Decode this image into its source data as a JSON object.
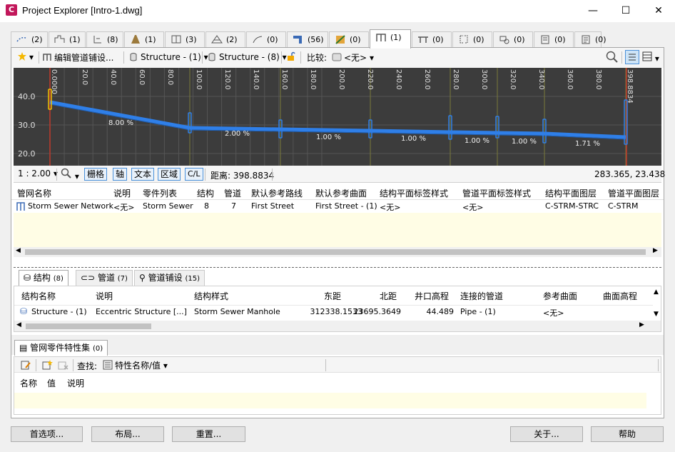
{
  "window": {
    "app_icon": "C",
    "title": "Project Explorer [Intro-1.dwg]",
    "minimize": "—",
    "maximize": "☐",
    "close": "✕"
  },
  "tabs": [
    {
      "icon": "alignment-icon",
      "count": "(2)"
    },
    {
      "icon": "profile-icon",
      "count": "(1)"
    },
    {
      "icon": "profile-view-icon",
      "count": "(8)"
    },
    {
      "icon": "corridor-icon",
      "count": "(1)"
    },
    {
      "icon": "assembly-icon",
      "count": "(3)"
    },
    {
      "icon": "surface-icon",
      "count": "(2)"
    },
    {
      "icon": "feature-line-icon",
      "count": "(0)"
    },
    {
      "icon": "pipe-icon",
      "count": "(56)"
    },
    {
      "icon": "corridor-surface-icon",
      "count": "(0)"
    },
    {
      "icon": "pipe-network-icon",
      "count": "(1)"
    },
    {
      "icon": "pressure-network-icon",
      "count": "(0)"
    },
    {
      "icon": "section-icon",
      "count": "(0)"
    },
    {
      "icon": "parcel-icon",
      "count": "(0)"
    },
    {
      "icon": "sheet-icon",
      "count": "(0)"
    },
    {
      "icon": "report-icon",
      "count": "(0)"
    }
  ],
  "toolbar": {
    "edit_pipe": "编辑管道铺设...",
    "structure_a": "Structure - (1)",
    "structure_b": "Structure - (8)",
    "compare_label": "比较:",
    "compare_value": "<无>"
  },
  "profile": {
    "y_labels": [
      "40.0",
      "30.0",
      "20.0"
    ],
    "x_labels": [
      "0.0000",
      "20.0",
      "40.0",
      "60.0",
      "80.0",
      "100.0",
      "120.0",
      "140.0",
      "160.0",
      "180.0",
      "200.0",
      "220.0",
      "240.0",
      "260.0",
      "280.0",
      "300.0",
      "320.0",
      "340.0",
      "360.0",
      "380.0",
      "398.8834"
    ],
    "slopes": [
      "8.00 %",
      "2.00 %",
      "1.00 %",
      "1.00 %",
      "1.00 %",
      "1.00 %",
      "1.71 %"
    ]
  },
  "viewbar": {
    "scale": "1 : 2.00",
    "grid": "栅格",
    "axis": "轴",
    "text": "文本",
    "region": "区域",
    "cl": "C/L",
    "distance": "距离: 398.8834",
    "coords": "283.365, 23.438"
  },
  "network_table": {
    "headers": [
      "管网名称",
      "说明",
      "零件列表",
      "结构",
      "管道",
      "默认参考路线",
      "默认参考曲面",
      "结构平面标签样式",
      "管道平面标签样式",
      "结构平面图层",
      "管道平面图层"
    ],
    "row": [
      "Storm Sewer Network",
      "<无>",
      "Storm Sewer",
      "8",
      "7",
      "First Street",
      "First Street - (1)",
      "<无>",
      "<无>",
      "C-STRM-STRC",
      "C-STRM"
    ]
  },
  "subtabs": [
    {
      "label": "结构",
      "count": "(8)"
    },
    {
      "label": "管道",
      "count": "(7)"
    },
    {
      "label": "管道铺设",
      "count": "(15)"
    }
  ],
  "structure_table": {
    "headers": [
      "结构名称",
      "说明",
      "结构样式",
      "东距",
      "北距",
      "井口高程",
      "连接的管道",
      "参考曲面",
      "曲面高程"
    ],
    "row": [
      "Structure - (1)",
      "Eccentric Structure  [...]",
      "Storm Sewer Manhole",
      "312338.1533",
      "23695.3649",
      "44.489",
      "Pipe - (1)",
      "<无>",
      ""
    ]
  },
  "propset": {
    "tab_label": "管网零件特性集",
    "tab_count": "(0)",
    "find_label": "查找:",
    "find_value": "特性名称/值",
    "headers": [
      "名称",
      "值",
      "说明"
    ]
  },
  "buttons": {
    "preferences": "首选项...",
    "layout": "布局...",
    "reset": "重置...",
    "about": "关于...",
    "help": "帮助"
  }
}
